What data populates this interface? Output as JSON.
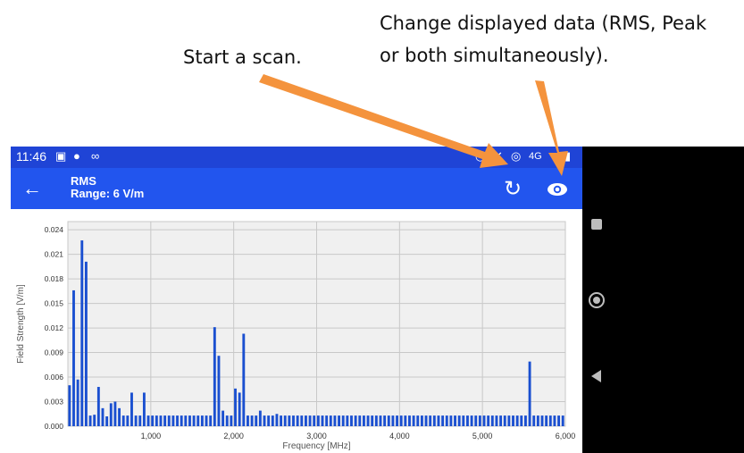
{
  "annotations": {
    "scan_text": "Start a scan.",
    "view_line1": "Change displayed data (RMS, Peak",
    "view_line2": "or both simultaneously)."
  },
  "statusbar": {
    "time": "11:46",
    "icons": [
      "calendar-icon",
      "notification-icon",
      "link-icon",
      "alarm-icon",
      "mute-icon",
      "hotspot-icon",
      "4g-icon",
      "battery-icon"
    ],
    "network": "4G"
  },
  "appbar": {
    "title": "RMS",
    "subtitle": "Range: 6 V/m",
    "back_icon": "arrow-left-icon",
    "refresh_icon": "refresh-icon",
    "view_icon": "eye-icon",
    "color": "#2255ee"
  },
  "chart_data": {
    "type": "bar",
    "xlabel": "Frequency [MHz]",
    "ylabel": "Field Strength [V/m]",
    "xlim": [
      0,
      6000
    ],
    "ylim": [
      0,
      0.025
    ],
    "xticks": [
      "1,000",
      "2,000",
      "3,000",
      "4,000",
      "5,000",
      "6,000"
    ],
    "yticks": [
      "0.000",
      "0.003",
      "0.006",
      "0.009",
      "0.012",
      "0.015",
      "0.018",
      "0.021",
      "0.024"
    ],
    "grid": true,
    "bar_color": "#1a4fd0",
    "x": [
      20,
      70,
      120,
      170,
      220,
      270,
      320,
      370,
      420,
      470,
      520,
      570,
      620,
      670,
      720,
      770,
      820,
      870,
      920,
      970,
      1020,
      1070,
      1120,
      1170,
      1220,
      1270,
      1320,
      1370,
      1420,
      1470,
      1520,
      1570,
      1620,
      1670,
      1720,
      1770,
      1820,
      1870,
      1920,
      1970,
      2020,
      2070,
      2120,
      2170,
      2220,
      2270,
      2320,
      2370,
      2420,
      2470,
      2520,
      2570,
      2620,
      2670,
      2720,
      2770,
      2820,
      2870,
      2920,
      2970,
      3020,
      3070,
      3120,
      3170,
      3220,
      3270,
      3320,
      3370,
      3420,
      3470,
      3520,
      3570,
      3620,
      3670,
      3720,
      3770,
      3820,
      3870,
      3920,
      3970,
      4020,
      4070,
      4120,
      4170,
      4220,
      4270,
      4320,
      4370,
      4420,
      4470,
      4520,
      4570,
      4620,
      4670,
      4720,
      4770,
      4820,
      4870,
      4920,
      4970,
      5020,
      5070,
      5120,
      5170,
      5220,
      5270,
      5320,
      5370,
      5420,
      5470,
      5520,
      5570,
      5620,
      5670,
      5720,
      5770,
      5820,
      5870,
      5920,
      5970
    ],
    "values": [
      0.005,
      0.0166,
      0.0057,
      0.0227,
      0.0201,
      0.0013,
      0.0014,
      0.0048,
      0.0022,
      0.0012,
      0.0028,
      0.003,
      0.0022,
      0.0013,
      0.0013,
      0.0041,
      0.0013,
      0.0013,
      0.0041,
      0.0013,
      0.0013,
      0.0013,
      0.0013,
      0.0013,
      0.0013,
      0.0013,
      0.0013,
      0.0013,
      0.0013,
      0.0013,
      0.0013,
      0.0013,
      0.0013,
      0.0013,
      0.0013,
      0.0121,
      0.0086,
      0.0019,
      0.0013,
      0.0013,
      0.0046,
      0.0041,
      0.0113,
      0.0013,
      0.0013,
      0.0013,
      0.0019,
      0.0013,
      0.0013,
      0.0013,
      0.0015,
      0.0013,
      0.0013,
      0.0013,
      0.0013,
      0.0013,
      0.0013,
      0.0013,
      0.0013,
      0.0013,
      0.0013,
      0.0013,
      0.0013,
      0.0013,
      0.0013,
      0.0013,
      0.0013,
      0.0013,
      0.0013,
      0.0013,
      0.0013,
      0.0013,
      0.0013,
      0.0013,
      0.0013,
      0.0013,
      0.0013,
      0.0013,
      0.0013,
      0.0013,
      0.0013,
      0.0013,
      0.0013,
      0.0013,
      0.0013,
      0.0013,
      0.0013,
      0.0013,
      0.0013,
      0.0013,
      0.0013,
      0.0013,
      0.0013,
      0.0013,
      0.0013,
      0.0013,
      0.0013,
      0.0013,
      0.0013,
      0.0013,
      0.0013,
      0.0013,
      0.0013,
      0.0013,
      0.0013,
      0.0013,
      0.0013,
      0.0013,
      0.0013,
      0.0013,
      0.0013,
      0.0079,
      0.0013,
      0.0013,
      0.0013,
      0.0013,
      0.0013,
      0.0013,
      0.0013,
      0.0013
    ]
  },
  "arrow_color": "#f4933d"
}
